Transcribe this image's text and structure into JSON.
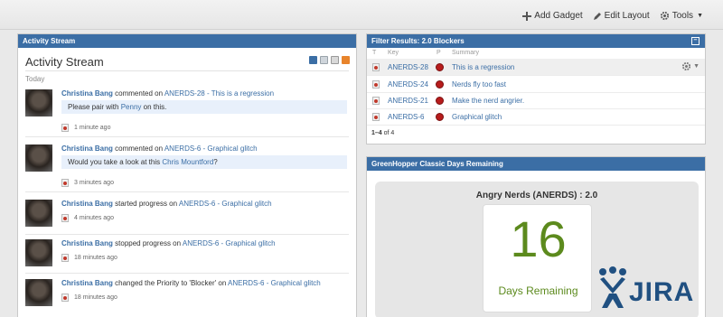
{
  "toolbar": {
    "add_gadget": "Add Gadget",
    "edit_layout": "Edit Layout",
    "tools": "Tools"
  },
  "activity_panel": {
    "header": "Activity Stream",
    "title": "Activity Stream",
    "today": "Today",
    "entries": [
      {
        "user": "Christina Bang",
        "action": "commented on",
        "issue": "ANERDS-28 - This is a regression",
        "comment_text": "Please pair with ",
        "comment_link": "Penny",
        "comment_end": " on this.",
        "time": "1 minute ago"
      },
      {
        "user": "Christina Bang",
        "action": "commented on",
        "issue": "ANERDS-6 - Graphical glitch",
        "comment_text": "Would you take a look at this ",
        "comment_link": "Chris Mountford",
        "comment_end": "?",
        "time": "3 minutes ago"
      },
      {
        "user": "Christina Bang",
        "action": "started progress on",
        "issue": "ANERDS-6 - Graphical glitch",
        "time": "4 minutes ago"
      },
      {
        "user": "Christina Bang",
        "action": "stopped progress on",
        "issue": "ANERDS-6 - Graphical glitch",
        "time": "18 minutes ago"
      },
      {
        "user": "Christina Bang",
        "action": "changed the Priority to 'Blocker' on",
        "issue": "ANERDS-6 - Graphical glitch",
        "time": "18 minutes ago"
      }
    ],
    "icons": [
      "list-view-icon",
      "document-icon",
      "filter-icon",
      "rss-icon"
    ]
  },
  "filter_panel": {
    "header": "Filter Results: 2.0 Blockers",
    "columns": {
      "type": "T",
      "key": "Key",
      "priority": "P",
      "summary": "Summary"
    },
    "rows": [
      {
        "key": "ANERDS-28",
        "summary": "This is a regression"
      },
      {
        "key": "ANERDS-24",
        "summary": "Nerds fly too fast"
      },
      {
        "key": "ANERDS-21",
        "summary": "Make the nerd angrier."
      },
      {
        "key": "ANERDS-6",
        "summary": "Graphical glitch"
      }
    ],
    "pager": {
      "range": "1–4",
      "of": "of 4"
    }
  },
  "days_panel": {
    "header": "GreenHopper Classic Days Remaining",
    "project": "Angry Nerds (ANERDS) : 2.0",
    "days": "16",
    "label": "Days Remaining"
  },
  "logo": {
    "text": "JIRA"
  },
  "colors": {
    "header_blue": "#3b6ea5",
    "link_blue": "#3b6ea5",
    "days_green": "#5c8a1d",
    "blocker_red": "#b71c1c",
    "jira_blue": "#205081"
  }
}
